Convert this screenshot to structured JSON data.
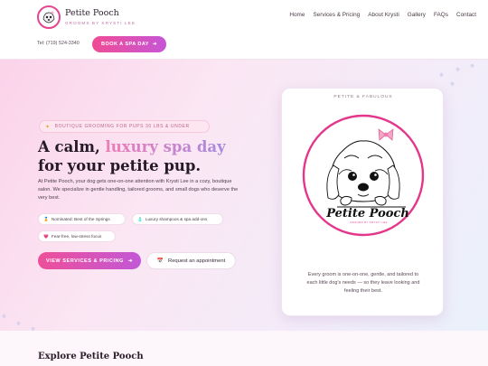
{
  "header": {
    "brand_name": "Petite Pooch",
    "brand_sub": "GROOMS BY KRYSTI LEE",
    "nav": [
      "Home",
      "Services & Pricing",
      "About Krysti",
      "Gallery",
      "FAQs",
      "Contact"
    ],
    "tel": "Tel: (719) 524-3340",
    "book_label": "BOOK A SPA DAY"
  },
  "hero": {
    "tag": "BOUTIQUE GROOMING FOR PUPS 30 LBS & UNDER",
    "headline_1": "A calm, ",
    "headline_accent": "luxury spa day",
    "headline_2": " for your petite pup.",
    "description": "At Petite Pooch, your dog gets one-on-one attention with Krysti Lee in a cozy, boutique salon. We specialize in gentle handling, tailored grooms, and small dogs who deserve the very best.",
    "chips": [
      {
        "icon": "medal-icon",
        "label": "Nominated: Best of the Springs"
      },
      {
        "icon": "shampoo-icon",
        "label": "Luxury shampoos & spa add-ons"
      },
      {
        "icon": "heart-icon",
        "label": "Fear-free, low-stress focus"
      }
    ],
    "services_label": "VIEW SERVICES & PRICING",
    "appt_label": "Request an appointment"
  },
  "card": {
    "label": "PETITE & FABULOUS",
    "logo_text": "Petite Pooch",
    "logo_sub": "GROOMS BY KRYSTI LEE",
    "text": "Every groom is one-on-one, gentle, and tailored to each little dog's needs — so they leave looking and feeling their best."
  },
  "section": {
    "explore": "Explore Petite Pooch"
  },
  "colors": {
    "accent_pink": "#ee4f99",
    "accent_purple": "#c258d7",
    "ring_pink": "#e4368a"
  }
}
